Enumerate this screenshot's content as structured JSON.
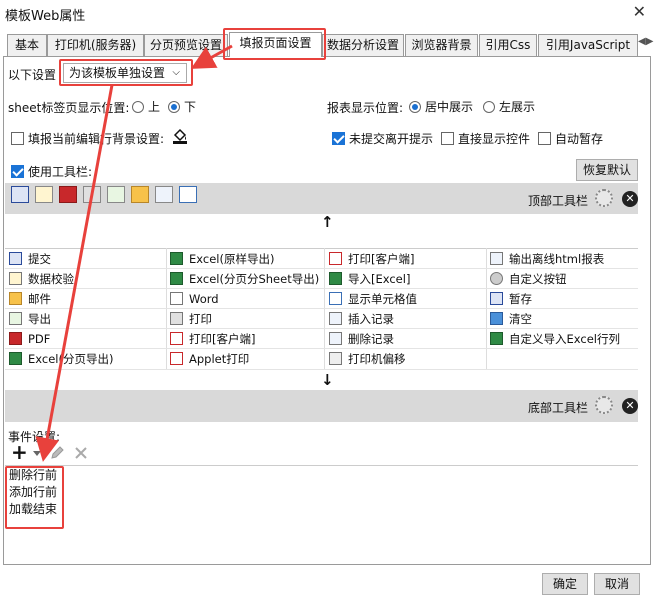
{
  "window": {
    "title": "模板Web属性",
    "close_glyph": "✕"
  },
  "tabs": [
    {
      "label": "基本"
    },
    {
      "label": "打印机(服务器)"
    },
    {
      "label": "分页预览设置"
    },
    {
      "label": "填报页面设置"
    },
    {
      "label": "数据分析设置"
    },
    {
      "label": "浏览器背景"
    },
    {
      "label": "引用Css"
    },
    {
      "label": "引用JavaScript"
    }
  ],
  "settings": {
    "following_label": "以下设置",
    "scope_value": "为该模板单独设置",
    "sheet_label": "sheet标签页显示位置:",
    "sheet_top": "上",
    "sheet_bottom": "下",
    "report_pos_label": "报表显示位置:",
    "center": "居中展示",
    "left": "左展示",
    "fill_bg_label": "填报当前编辑行背景设置:",
    "unsubmitted": "未提交离开提示",
    "direct_show": "直接显示控件",
    "autosave": "自动暂存",
    "use_toolbar": "使用工具栏:",
    "restore_default": "恢复默认"
  },
  "toolbar": {
    "top_label": "顶部工具栏",
    "bottom_label": "底部工具栏",
    "up_arrow": "↑",
    "down_arrow": "↓"
  },
  "buttons_grid": [
    [
      "提交",
      "Excel(原样导出)",
      "打印[客户端]",
      "输出离线html报表"
    ],
    [
      "数据校验",
      "Excel(分页分Sheet导出)",
      "导入[Excel]",
      "自定义按钮"
    ],
    [
      "邮件",
      "Word",
      "显示单元格值",
      "暂存"
    ],
    [
      "导出",
      "打印",
      "插入记录",
      "清空"
    ],
    [
      "PDF",
      "打印[客户端]",
      "删除记录",
      "自定义导入Excel行列"
    ],
    [
      "Excel(分页导出)",
      "Applet打印",
      "打印机偏移",
      ""
    ]
  ],
  "events": {
    "label": "事件设置:",
    "add": "+",
    "items": [
      "删除行前",
      "添加行前",
      "加载结束"
    ]
  },
  "footer": {
    "ok": "确定",
    "cancel": "取消"
  },
  "colors": {
    "highlight": "#e8413c",
    "accent": "#1a73d6"
  }
}
